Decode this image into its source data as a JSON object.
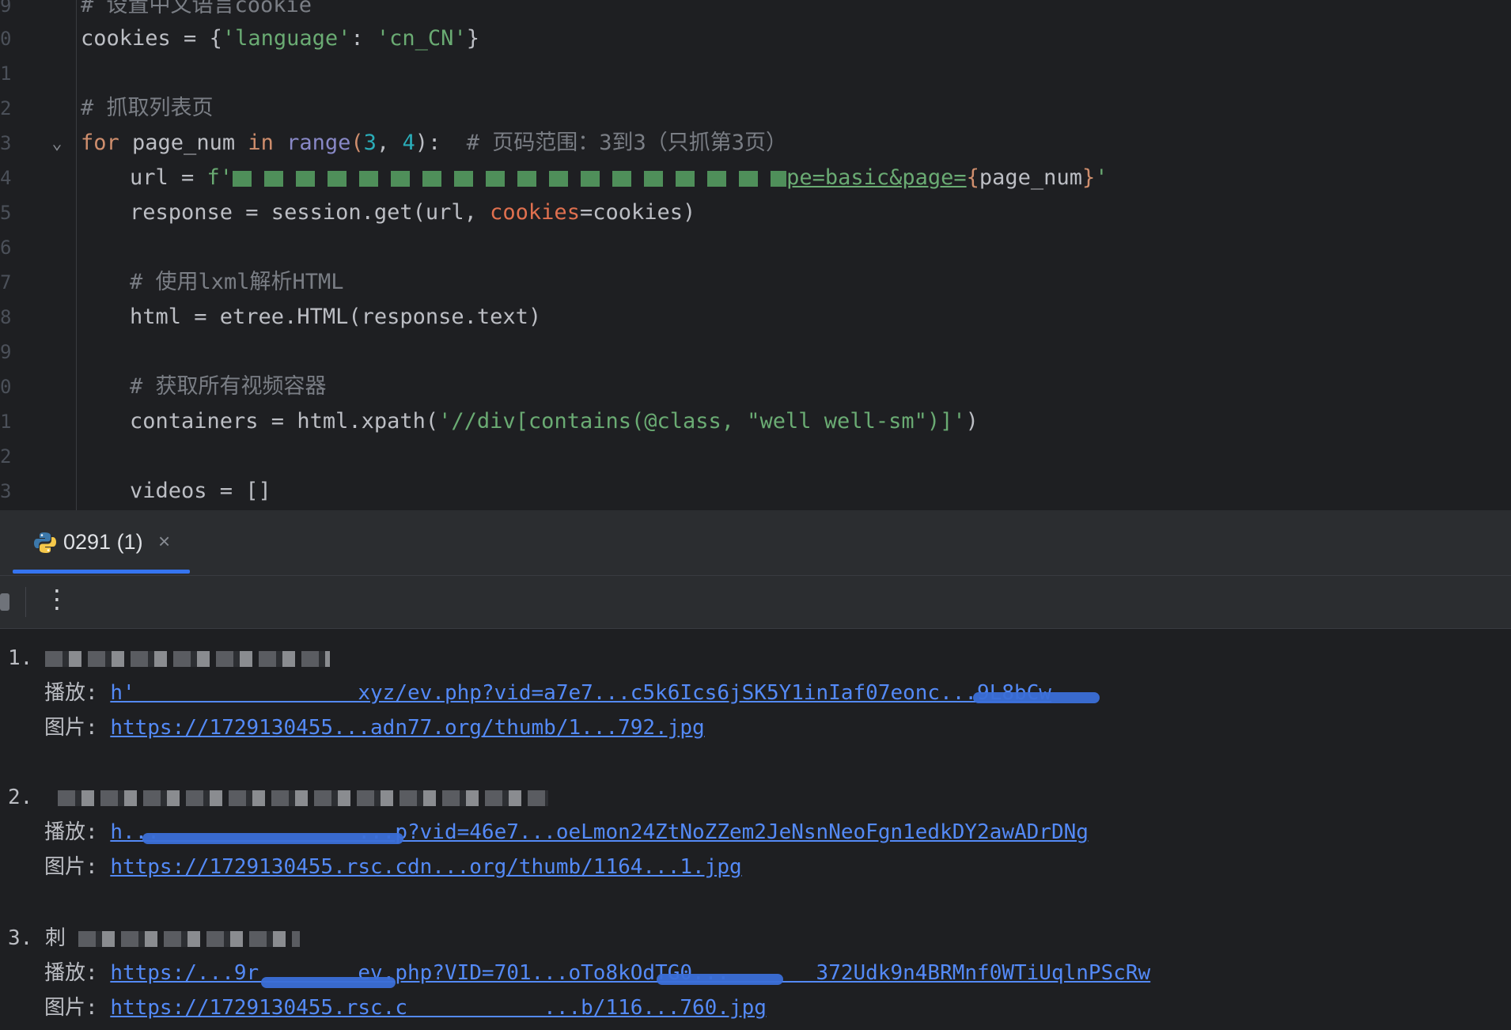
{
  "editor": {
    "line_numbers": [
      "9",
      "0",
      "1",
      "2",
      "3",
      "4",
      "5",
      "6",
      "7",
      "8",
      "9",
      "0",
      "1",
      "2",
      "3"
    ],
    "lines": {
      "l9": "# 设置中文语言cookie",
      "l10_var": "cookies",
      "l10_eq": " = {",
      "l10_key": "'language'",
      "l10_colon": ": ",
      "l10_val": "'cn_CN'",
      "l10_end": "}",
      "l12": "# 抓取列表页",
      "l13_for": "for",
      "l13_var": " page_num ",
      "l13_in": "in",
      "l13_range": " range",
      "l13_open": "(",
      "l13_n1": "3",
      "l13_comma": ", ",
      "l13_n2": "4",
      "l13_close": "):",
      "l13_cmt": "  # 页码范围：3到3（只抓第3页）",
      "l14_pre": "url = ",
      "l14_f": "f'",
      "l14_link": "pe=basic&page=",
      "l14_brace_open": "{",
      "l14_var": "page_num",
      "l14_brace_close": "}",
      "l14_end": "'",
      "l15_pre": "response = session.get(url, ",
      "l15_param": "cookies",
      "l15_post": "=cookies)",
      "l17": "# 使用lxml解析HTML",
      "l18": "html = etree.HTML(response.text)",
      "l20": "# 获取所有视频容器",
      "l21_pre": "containers = html.xpath(",
      "l21_str": "'//div[contains(@class, \"well well-sm\")]'",
      "l21_post": ")",
      "l23": "videos = []"
    }
  },
  "run_tab": {
    "label": "0291 (1)",
    "close": "×"
  },
  "toolbar": {
    "more": "⋮"
  },
  "console": {
    "entries": [
      {
        "index": "1.",
        "play_label": "播放: ",
        "play_link": "h'                  xyz/ev.php?vid=a7e7...c5k6Ics6jSK5Y1inIaf07eonc...9L8bCw",
        "image_label": "图片: ",
        "image_link": "https://1729130455...adn77.org/thumb/1...792.jpg"
      },
      {
        "index": "2.",
        "play_label": "播放: ",
        "play_link": "h...                ...p?vid=46e7...oeLmon24ZtNoZZem2JeNsnNeoFgn1edkDY2awADrDNg",
        "image_label": "图片: ",
        "image_link": "https://1729130455.rsc.cdn...org/thumb/1164...1.jpg"
      },
      {
        "index": "3.",
        "lead": "刺",
        "play_label": "播放: ",
        "play_link": "https:/...9r        ev.php?VID=701...oTo8kOdTG0...       372Udk9n4BRMnf0WTiUqlnPScRw",
        "image_label": "图片: ",
        "image_link": "https://1729130455.rsc.c           ...b/116...760.jpg"
      }
    ]
  },
  "colors": {
    "background": "#1e1f22",
    "keyword": "#cf8e6d",
    "string": "#6aab73",
    "number": "#2aacb8",
    "comment": "#7a7e85",
    "link": "#548af7",
    "tab_underline": "#3574f0"
  }
}
